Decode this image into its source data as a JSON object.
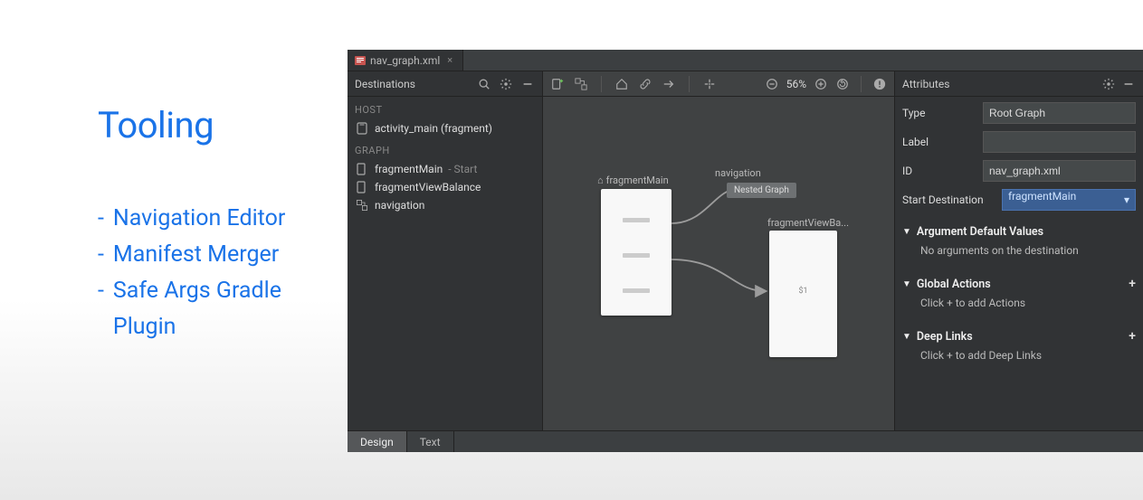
{
  "slide": {
    "title": "Tooling",
    "items": [
      "Navigation Editor",
      "Manifest Merger",
      "Safe Args Gradle Plugin"
    ]
  },
  "ide": {
    "tab_filename": "nav_graph.xml",
    "left": {
      "title": "Destinations",
      "host_header": "HOST",
      "host_item": "activity_main (fragment)",
      "graph_header": "GRAPH",
      "items": [
        {
          "name": "fragmentMain",
          "suffix": " - Start"
        },
        {
          "name": "fragmentViewBalance",
          "suffix": ""
        },
        {
          "name": "navigation",
          "suffix": ""
        }
      ]
    },
    "canvas": {
      "zoom": "56%",
      "frag_a_label": "fragmentMain",
      "nav_label": "navigation",
      "nested_chip": "Nested Graph",
      "frag_b_label": "fragmentViewBa...",
      "frag_b_center": "$1"
    },
    "right": {
      "title": "Attributes",
      "rows": {
        "type_label": "Type",
        "type_value": "Root Graph",
        "label_label": "Label",
        "label_value": "",
        "id_label": "ID",
        "id_value": "nav_graph.xml",
        "start_label": "Start Destination",
        "start_value": "fragmentMain"
      },
      "sections": {
        "adv_title": "Argument Default Values",
        "adv_body": "No arguments on the destination",
        "ga_title": "Global Actions",
        "ga_body": "Click + to add Actions",
        "dl_title": "Deep Links",
        "dl_body": "Click + to add Deep Links"
      }
    },
    "bottom": {
      "design": "Design",
      "text": "Text"
    }
  }
}
